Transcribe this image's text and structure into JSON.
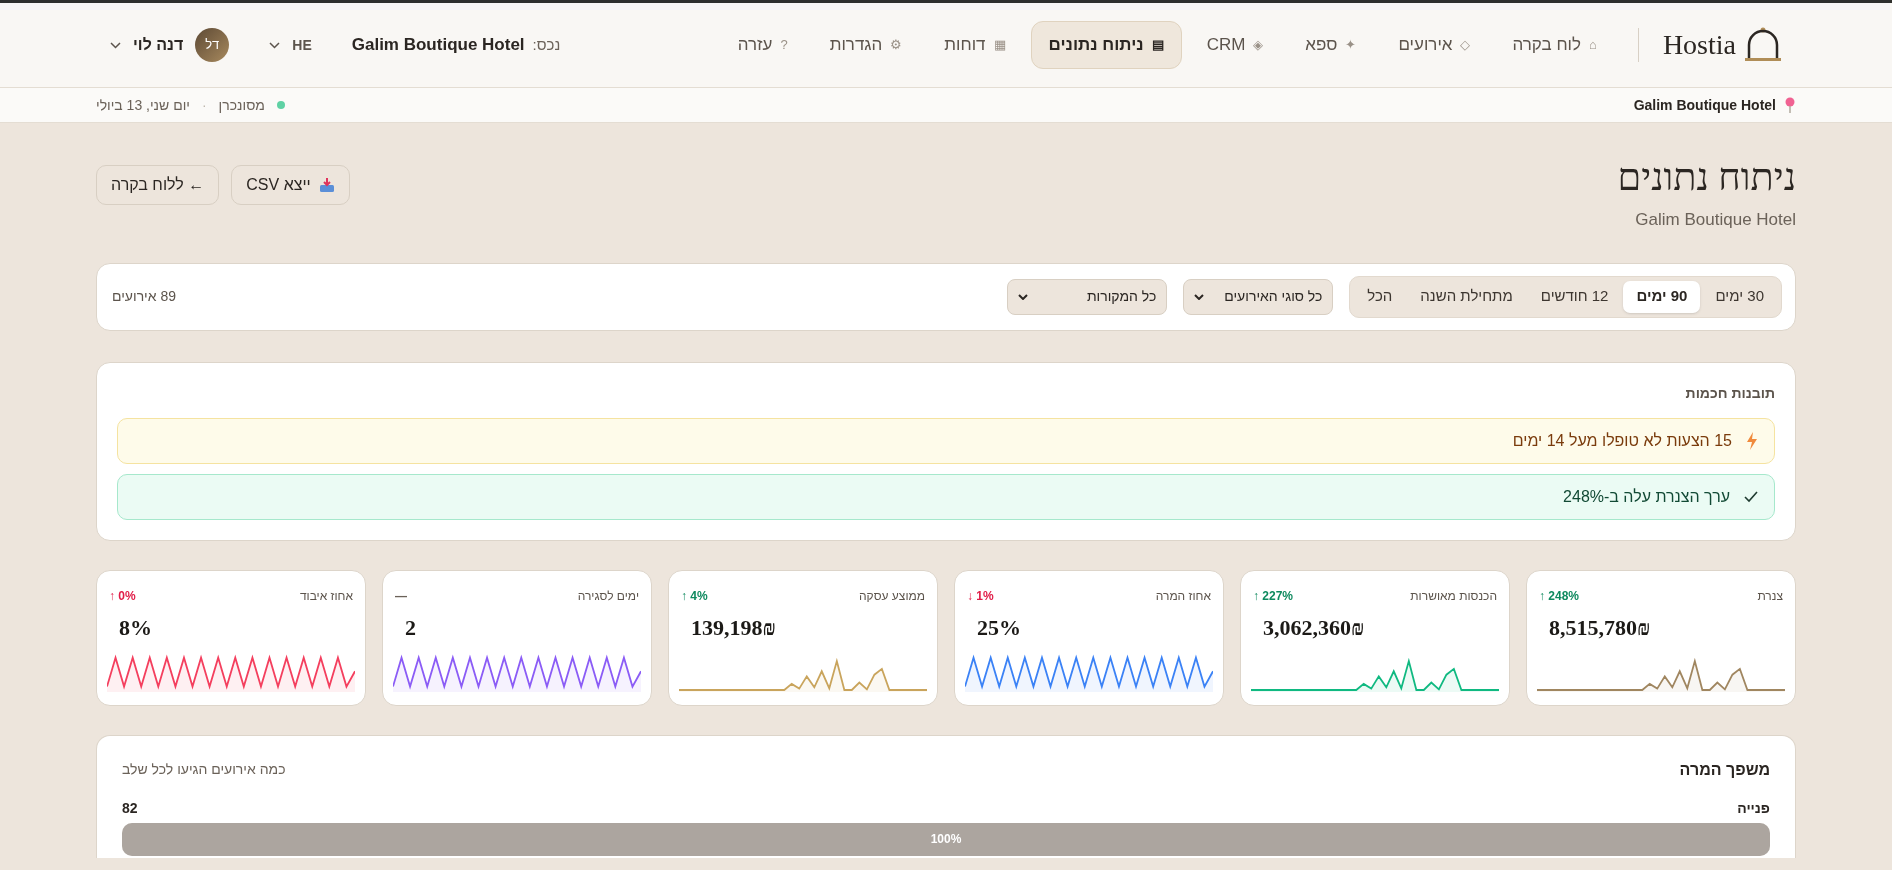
{
  "brand": {
    "name": "Hostia"
  },
  "nav": [
    {
      "label": "לוח בקרה",
      "icon": "⌂",
      "selected": false
    },
    {
      "label": "אירועים",
      "icon": "◇",
      "selected": false
    },
    {
      "label": "ספא",
      "icon": "✦",
      "selected": false
    },
    {
      "label": "CRM",
      "icon": "◈",
      "selected": false
    },
    {
      "label": "ניתוח נתונים",
      "icon": "▤",
      "selected": true
    },
    {
      "label": "דוחות",
      "icon": "▦",
      "selected": false
    },
    {
      "label": "הגדרות",
      "icon": "⚙",
      "selected": false
    },
    {
      "label": "עזרה",
      "icon": "?",
      "selected": false
    }
  ],
  "property": {
    "label": "נכס:",
    "value": "Galim Boutique Hotel"
  },
  "language": "HE",
  "user": {
    "initials": "דל",
    "name": "דנה לוי"
  },
  "subbar": {
    "hotel": "Galim Boutique Hotel",
    "sync": "מסונכרן",
    "separator": "·",
    "date": "יום שני, 13 ביולי"
  },
  "page": {
    "title": "ניתוח נתונים",
    "subtitle": "Galim Boutique Hotel",
    "actions": [
      {
        "kind": "export",
        "label": "ייצא CSV"
      },
      {
        "kind": "back",
        "label": "← ללוח בקרה"
      }
    ]
  },
  "filters": {
    "periods": [
      {
        "label": "30 ימים",
        "selected": false
      },
      {
        "label": "90 ימים",
        "selected": true
      },
      {
        "label": "12 חודשים",
        "selected": false
      },
      {
        "label": "מתחילת השנה",
        "selected": false
      },
      {
        "label": "הכל",
        "selected": false
      }
    ],
    "selects": [
      "כל סוגי האירועים",
      "כל המקורות"
    ],
    "count": "89 אירועים"
  },
  "insights": {
    "title": "תובנות חכמות",
    "items": [
      {
        "kind": "warning",
        "text": "15 הצעות לא טופלו מעל 14 ימים"
      },
      {
        "kind": "success",
        "text": "ערך הצנרת עלה ב-248%"
      }
    ]
  },
  "kpis": [
    {
      "label": "צנרת",
      "delta": {
        "text": "↑ 248%",
        "color": "#0f8a5f"
      },
      "value": "8,515,780₪",
      "color": "#a08660",
      "kind": "peaks"
    },
    {
      "label": "הכנסות מאושרות",
      "delta": {
        "text": "↑ 227%",
        "color": "#0f8a5f"
      },
      "value": "3,062,360₪",
      "color": "#10b981",
      "kind": "peaks"
    },
    {
      "label": "אחוז המרה",
      "delta": {
        "text": "↓ 1%",
        "color": "#e11d48"
      },
      "value": "25%",
      "color": "#3b82f6",
      "kind": "zigzag"
    },
    {
      "label": "ממוצע עסקה",
      "delta": {
        "text": "↑ 4%",
        "color": "#0f8a5f"
      },
      "value": "139,198₪",
      "color": "#c9a45c",
      "kind": "peaks"
    },
    {
      "label": "ימים לסגירה",
      "delta": {
        "text": "—",
        "color": "#6b6259"
      },
      "value": "2",
      "color": "#8b5cf6",
      "kind": "zigzag"
    },
    {
      "label": "אחוז איבוד",
      "delta": {
        "text": "↑ 0%",
        "color": "#e11d48"
      },
      "value": "8%",
      "color": "#f43f5e",
      "kind": "zigzag"
    }
  ],
  "funnel": {
    "title": "משפך המרה",
    "subtitle": "כמה אירועים הגיעו לכל שלב",
    "stages": [
      {
        "name": "פנייה",
        "count": "82",
        "level": 1,
        "percent": "100%"
      }
    ]
  }
}
